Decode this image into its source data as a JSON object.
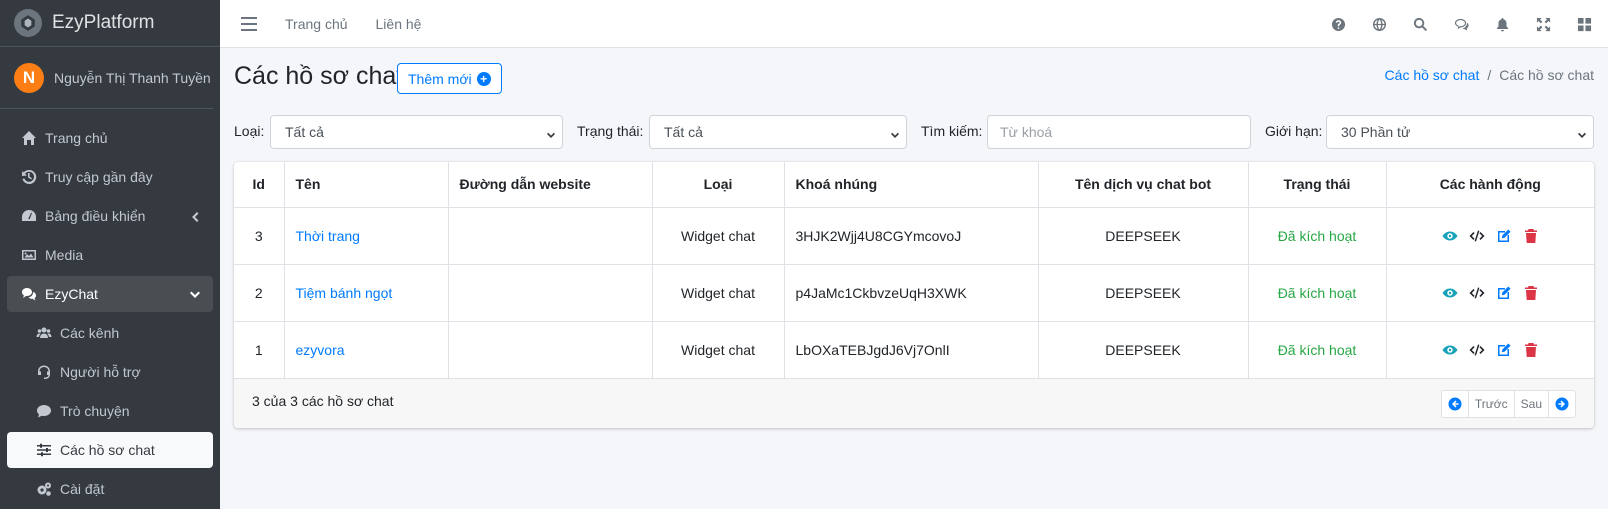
{
  "app": {
    "brand": "EzyPlatform",
    "user_initial": "N",
    "user_name": "Nguyễn Thị Thanh Tuyền"
  },
  "sidebar": {
    "items": [
      {
        "label": "Trang chủ",
        "icon": "home-icon"
      },
      {
        "label": "Truy cập gần đây",
        "icon": "history-icon"
      },
      {
        "label": "Bảng điều khiển",
        "icon": "dashboard-icon"
      },
      {
        "label": "Media",
        "icon": "image-icon"
      },
      {
        "label": "EzyChat",
        "icon": "comments-icon"
      },
      {
        "label": "Các kênh",
        "icon": "users-icon"
      },
      {
        "label": "Người hỗ trợ",
        "icon": "headset-icon"
      },
      {
        "label": "Trò chuyện",
        "icon": "comment-icon"
      },
      {
        "label": "Các hồ sơ chat",
        "icon": "sliders-icon"
      },
      {
        "label": "Cài đặt",
        "icon": "cogs-icon"
      }
    ]
  },
  "topbar": {
    "links": [
      "Trang chủ",
      "Liên hệ"
    ]
  },
  "page": {
    "title": "Các hồ sơ chat",
    "add_button": "Thêm mới",
    "breadcrumb": {
      "parent": "Các hồ sơ chat",
      "current": "Các hồ sơ chat"
    }
  },
  "filters": {
    "type_label": "Loại:",
    "type_value": "Tất cả",
    "status_label": "Trạng thái:",
    "status_value": "Tất cả",
    "search_label": "Tìm kiếm:",
    "search_placeholder": "Từ khoá",
    "limit_label": "Giới hạn:",
    "limit_value": "30 Phần tử"
  },
  "table": {
    "headers": [
      "Id",
      "Tên",
      "Đường dẫn website",
      "Loại",
      "Khoá nhúng",
      "Tên dịch vụ chat bot",
      "Trạng thái",
      "Các hành động"
    ],
    "rows": [
      {
        "id": "3",
        "name": "Thời trang",
        "website": "",
        "type": "Widget chat",
        "key": "3HJK2Wjj4U8CGYmcovoJ",
        "bot": "DEEPSEEK",
        "status": "Đã kích hoạt"
      },
      {
        "id": "2",
        "name": "Tiệm bánh ngọt",
        "website": "",
        "type": "Widget chat",
        "key": "p4JaMc1CkbvzeUqH3XWK",
        "bot": "DEEPSEEK",
        "status": "Đã kích hoạt"
      },
      {
        "id": "1",
        "name": "ezyvora",
        "website": "",
        "type": "Widget chat",
        "key": "LbOXaTEBJgdJ6Vj7OnlI",
        "bot": "DEEPSEEK",
        "status": "Đã kích hoạt"
      }
    ]
  },
  "footer": {
    "summary": "3 của 3 các hồ sơ chat",
    "prev": "Trước",
    "next": "Sau"
  },
  "colors": {
    "sidebar": "#343a40",
    "accent": "#007bff",
    "success": "#28a745",
    "danger": "#dc3545"
  }
}
